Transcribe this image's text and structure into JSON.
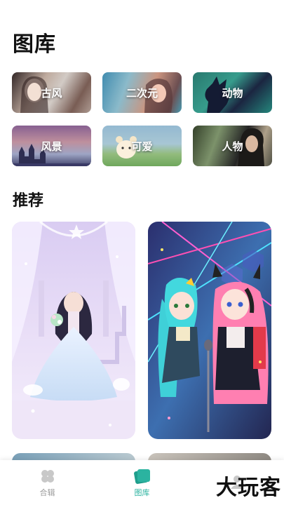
{
  "page_title": "图库",
  "categories": [
    {
      "label": "古风",
      "icon": "ancient-style-image"
    },
    {
      "label": "二次元",
      "icon": "anime-image"
    },
    {
      "label": "动物",
      "icon": "animal-image"
    },
    {
      "label": "风景",
      "icon": "scenery-image"
    },
    {
      "label": "可爱",
      "icon": "cute-image"
    },
    {
      "label": "人物",
      "icon": "people-image"
    }
  ],
  "recommend_title": "推荐",
  "tabbar": {
    "items": [
      {
        "label": "合辑",
        "icon": "clover-icon",
        "active": false
      },
      {
        "label": "图库",
        "icon": "gallery-icon",
        "active": true
      },
      {
        "label": "",
        "icon": "user-icon",
        "active": false
      }
    ]
  },
  "watermark": "大玩客",
  "colors": {
    "accent": "#2bb3a0",
    "inactive": "#9a9a9a"
  }
}
